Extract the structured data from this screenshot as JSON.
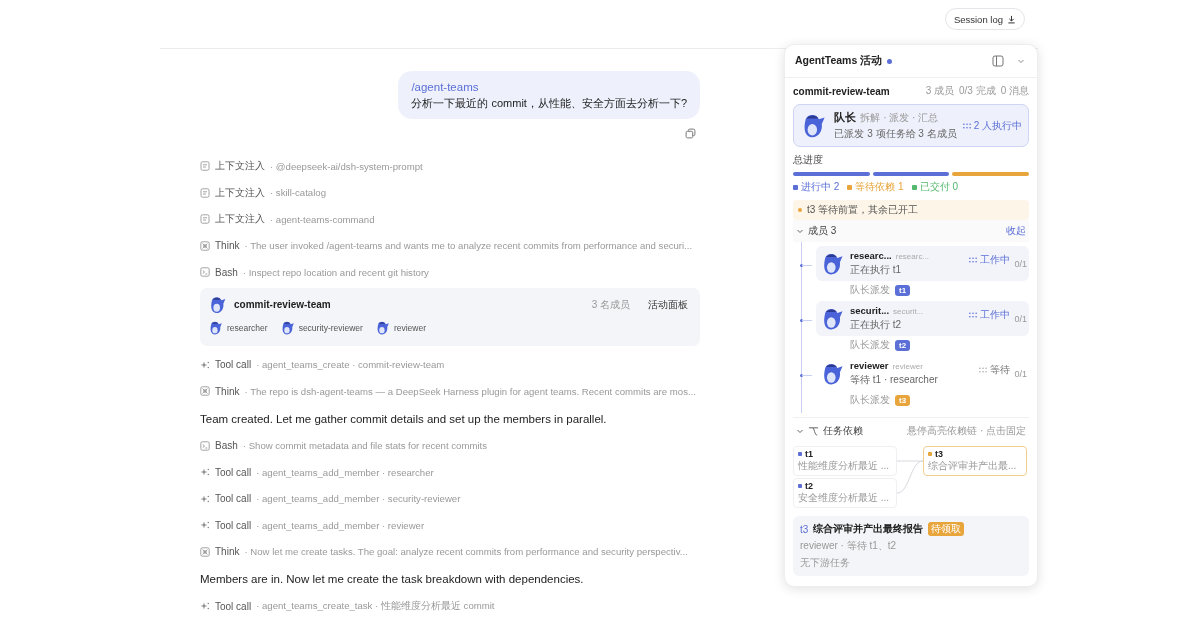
{
  "header": {
    "session_log": "Session log"
  },
  "user_message": {
    "command": "/agent-teams",
    "text": "分析一下最近的 commit，从性能、安全方面去分析一下?"
  },
  "timeline": [
    {
      "kind": "context",
      "label": "上下文注入",
      "detail": "· @deepseek-ai/dsh-system-prompt"
    },
    {
      "kind": "context",
      "label": "上下文注入",
      "detail": "· skill-catalog"
    },
    {
      "kind": "context",
      "label": "上下文注入",
      "detail": "· agent-teams-command"
    },
    {
      "kind": "think",
      "label": "Think",
      "detail": "· The user invoked /agent-teams and wants me to analyze recent commits from performance and securi..."
    },
    {
      "kind": "bash",
      "label": "Bash",
      "detail": "· Inspect repo location and recent git history"
    },
    {
      "kind": "team",
      "name": "commit-review-team",
      "count": "3 名成员",
      "action": "活动面板",
      "members": [
        "researcher",
        "security-reviewer",
        "reviewer"
      ]
    },
    {
      "kind": "tool",
      "label": "Tool call",
      "detail": "· agent_teams_create · commit-review-team"
    },
    {
      "kind": "think",
      "label": "Think",
      "detail": "· The repo is dsh-agent-teams — a DeepSeek Harness plugin for agent teams. Recent commits are mos..."
    },
    {
      "kind": "text",
      "text": "Team created. Let me gather commit details and set up the members in parallel."
    },
    {
      "kind": "bash",
      "label": "Bash",
      "detail": "· Show commit metadata and file stats for recent commits"
    },
    {
      "kind": "tool",
      "label": "Tool call",
      "detail": "· agent_teams_add_member · researcher"
    },
    {
      "kind": "tool",
      "label": "Tool call",
      "detail": "· agent_teams_add_member · security-reviewer"
    },
    {
      "kind": "tool",
      "label": "Tool call",
      "detail": "· agent_teams_add_member · reviewer"
    },
    {
      "kind": "think",
      "label": "Think",
      "detail": "· Now let me create tasks. The goal: analyze recent commits from performance and security perspectiv..."
    },
    {
      "kind": "text",
      "text": "Members are in. Now let me create the task breakdown with dependencies."
    },
    {
      "kind": "tool",
      "label": "Tool call",
      "detail": "· agent_teams_create_task · 性能维度分析最近 commit"
    }
  ],
  "panel": {
    "title": "AgentTeams 活动",
    "live": true,
    "team": "commit-review-team",
    "stats": [
      "3 成员",
      "0/3 完成",
      "0 消息"
    ],
    "leader": {
      "name": "队长",
      "roles": "拆解 · 派发 · 汇总",
      "summary": "已派发 3 项任务给 3 名成员",
      "status": "2 人执行中"
    },
    "progress_label": "总进度",
    "progress_segments": [
      {
        "color": "#5b6fd6"
      },
      {
        "color": "#5b6fd6"
      },
      {
        "color": "#e8a53c"
      }
    ],
    "legend": [
      {
        "label": "进行中 2",
        "color": "#5b6fd6"
      },
      {
        "label": "等待依赖 1",
        "color": "#e8a53c"
      },
      {
        "label": "已交付 0",
        "color": "#52b96e"
      }
    ],
    "notice": "t3 等待前置，其余已开工",
    "members_header": {
      "label": "成员 3",
      "expanded": true,
      "action": "收起"
    },
    "members": [
      {
        "name": "researc...",
        "role": "researc...",
        "active": true,
        "status": "工作中",
        "task_text": "正在执行 t1",
        "progress": "0/1",
        "assigned": "队长派发",
        "task": "t1",
        "color": "#5b6fd6"
      },
      {
        "name": "securit...",
        "role": "securit...",
        "active": true,
        "status": "工作中",
        "task_text": "正在执行 t2",
        "progress": "0/1",
        "assigned": "队长派发",
        "task": "t2",
        "color": "#5b6fd6"
      },
      {
        "name": "reviewer",
        "role": "reviewer",
        "active": false,
        "status": "等待",
        "task_text": "等待 t1 · researcher",
        "progress": "0/1",
        "assigned": "队长派发",
        "task": "t3",
        "color": "#e8a53c"
      }
    ],
    "deps": {
      "label": "任务依赖",
      "expanded": true,
      "hint": "悬停高亮依赖链 · 点击固定",
      "nodes": [
        {
          "kind": "source",
          "id": "t1",
          "desc": "性能维度分析最近 ...",
          "color": "#5b6fd6",
          "selected": false
        },
        {
          "kind": "source",
          "id": "t2",
          "desc": "安全维度分析最近 ...",
          "color": "#5b6fd6",
          "selected": false
        },
        {
          "kind": "target",
          "id": "t3",
          "desc": "综合评审并产出最...",
          "color": "#e8a53c",
          "selected": true
        }
      ]
    },
    "task_detail": {
      "id": "t3",
      "title": "综合评审并产出最终报告",
      "badge": "待领取",
      "meta": "reviewer · 等待 t1、t2",
      "downstream": "无下游任务"
    }
  }
}
